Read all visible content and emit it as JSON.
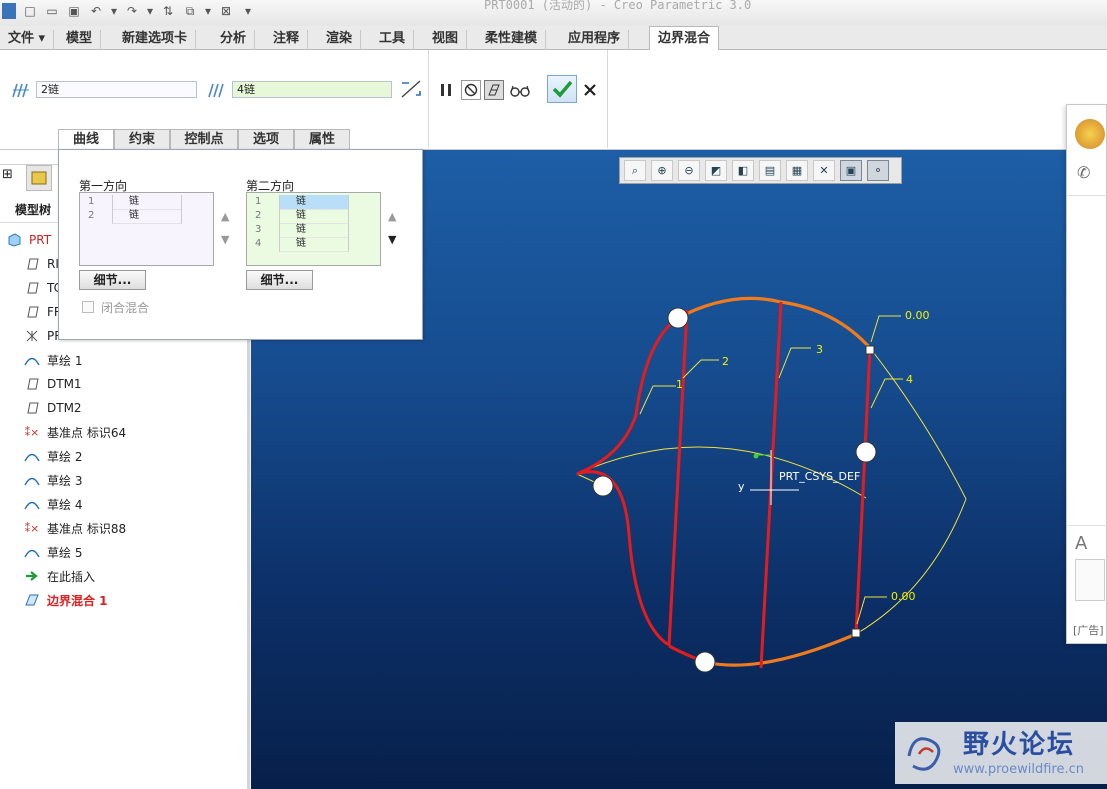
{
  "app": {
    "window_title": "PRT0001 (活动的) - Creo Parametric 3.0"
  },
  "ribbon": {
    "tabs": [
      {
        "label": "文件 ▾"
      },
      {
        "label": "模型"
      },
      {
        "label": "新建选项卡"
      },
      {
        "label": "分析"
      },
      {
        "label": "注释"
      },
      {
        "label": "渲染"
      },
      {
        "label": "工具"
      },
      {
        "label": "视图"
      },
      {
        "label": "柔性建模"
      },
      {
        "label": "应用程序"
      },
      {
        "label": "边界混合"
      }
    ],
    "first_dir_field": "2链",
    "second_dir_field": "4链"
  },
  "panel_tabs": [
    {
      "label": "曲线"
    },
    {
      "label": "约束"
    },
    {
      "label": "控制点"
    },
    {
      "label": "选项"
    },
    {
      "label": "属性"
    }
  ],
  "curve_panel": {
    "first_direction": {
      "label": "第一方向",
      "rows": [
        {
          "num": "1",
          "value": "链"
        },
        {
          "num": "2",
          "value": "链"
        }
      ],
      "detail_button": "细节..."
    },
    "second_direction": {
      "label": "第二方向",
      "rows": [
        {
          "num": "1",
          "value": "链"
        },
        {
          "num": "2",
          "value": "链"
        },
        {
          "num": "3",
          "value": "链"
        },
        {
          "num": "4",
          "value": "链"
        }
      ],
      "detail_button": "细节..."
    },
    "closed_blend_label": "闭合混合",
    "closed_blend_checked": false
  },
  "model_tree": {
    "title": "模型树",
    "items": [
      {
        "label": "PRT",
        "icon": "part-icon"
      },
      {
        "label": "RI",
        "icon": "plane-icon"
      },
      {
        "label": "TC",
        "icon": "plane-icon"
      },
      {
        "label": "FR",
        "icon": "plane-icon"
      },
      {
        "label": "PR",
        "icon": "csys-icon"
      },
      {
        "label": "草绘 1",
        "icon": "sketch-icon"
      },
      {
        "label": "DTM1",
        "icon": "plane-icon"
      },
      {
        "label": "DTM2",
        "icon": "plane-icon"
      },
      {
        "label": "基准点 标识64",
        "icon": "datum-point-icon"
      },
      {
        "label": "草绘 2",
        "icon": "sketch-icon"
      },
      {
        "label": "草绘 3",
        "icon": "sketch-icon"
      },
      {
        "label": "草绘 4",
        "icon": "sketch-icon"
      },
      {
        "label": "基准点 标识88",
        "icon": "datum-point-icon"
      },
      {
        "label": "草绘 5",
        "icon": "sketch-icon"
      },
      {
        "label": "在此插入",
        "icon": "insert-arrow-icon"
      },
      {
        "label": "边界混合 1",
        "icon": "boundary-blend-icon"
      }
    ]
  },
  "graphics": {
    "curve_labels": [
      "1",
      "2",
      "3",
      "4"
    ],
    "constraint_value_top": "0.00",
    "constraint_value_bottom": "0.00",
    "csys_label": "PRT_CSYS_DEF",
    "axis_label": "y"
  },
  "right_popup": {
    "ad_text": "[广告]"
  },
  "watermark": {
    "title": "野火论坛",
    "url": "www.proewildfire.cn"
  },
  "colors": {
    "accent": "#e61c1c",
    "boundary": "#f07b1d",
    "label": "#f5f000",
    "bg": "#164c8f"
  }
}
